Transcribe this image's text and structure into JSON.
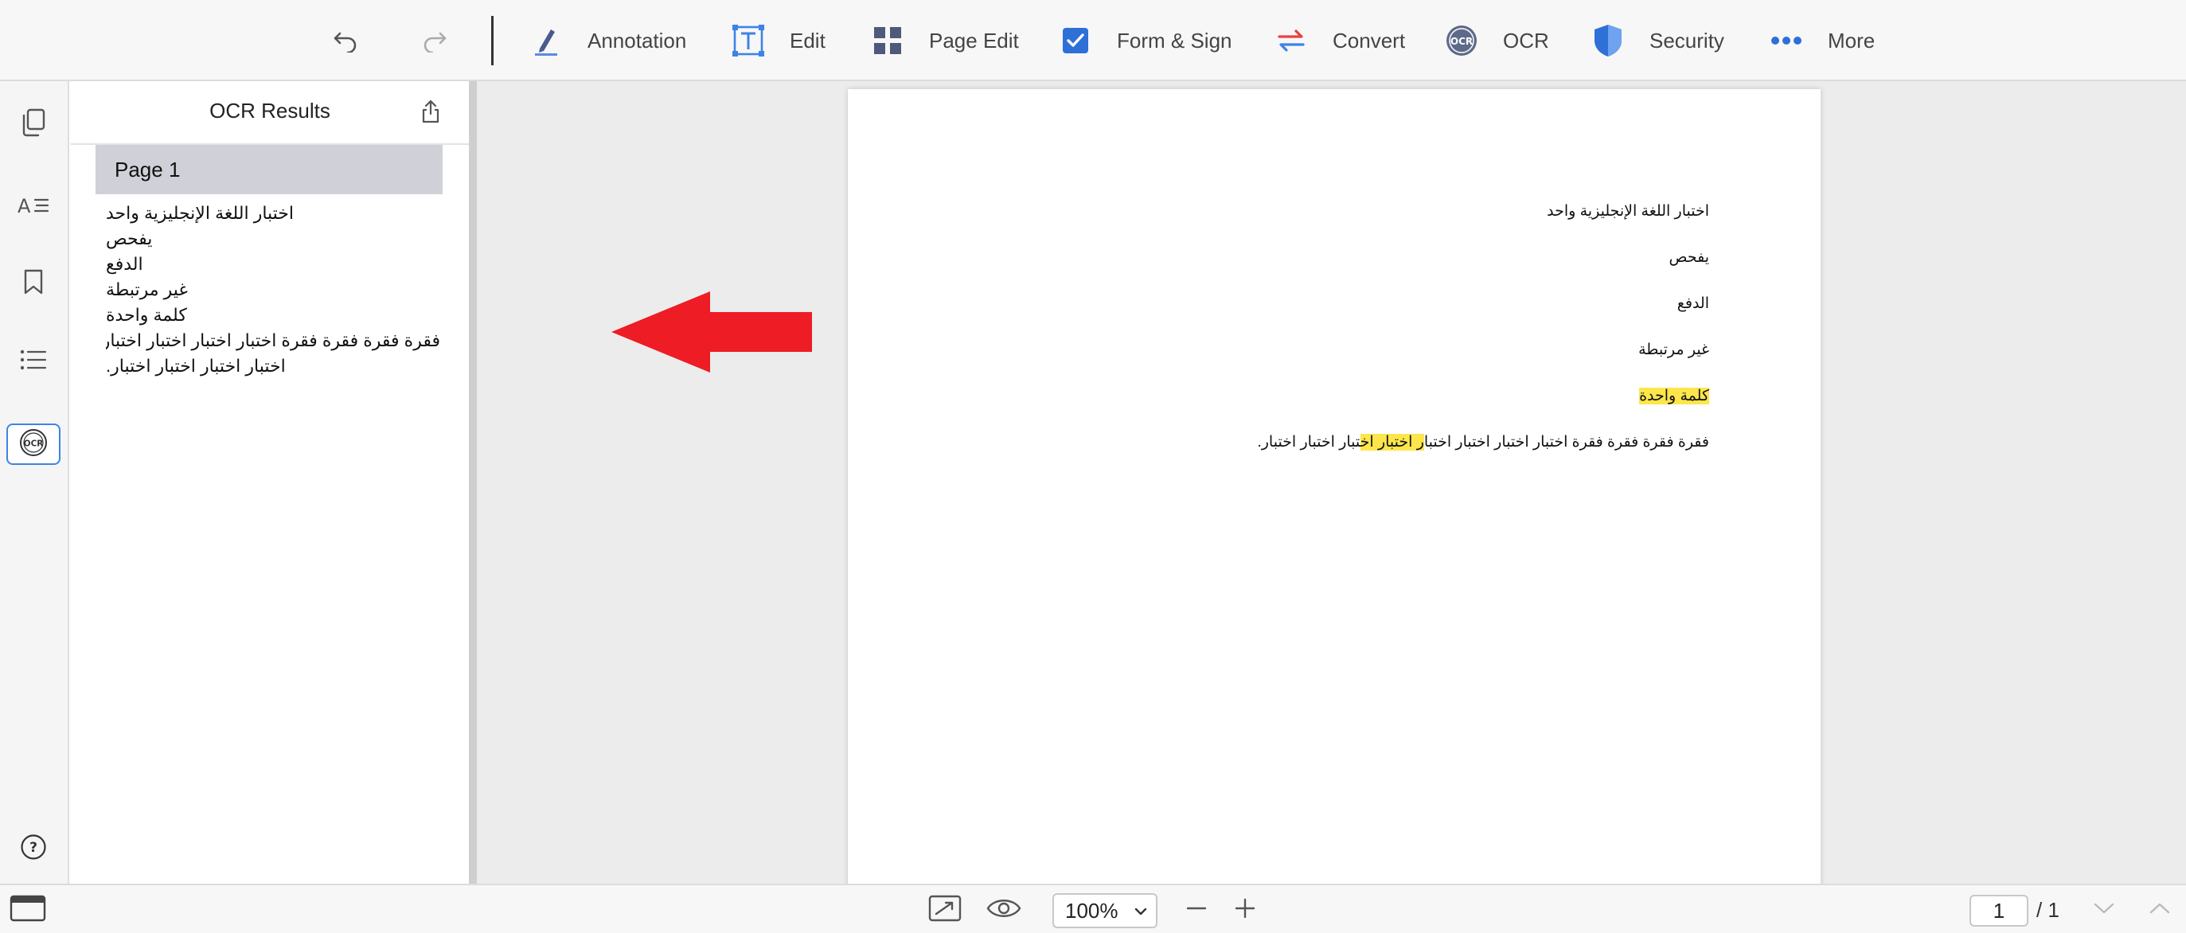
{
  "toolbar": {
    "annotation": "Annotation",
    "edit": "Edit",
    "page_edit": "Page Edit",
    "form_sign": "Form & Sign",
    "convert": "Convert",
    "ocr": "OCR",
    "security": "Security",
    "more": "More"
  },
  "panel": {
    "title": "OCR Results",
    "page_label": "Page 1",
    "lines": [
      "اختبار اللغة الإنجليزية واحد",
      "يفحص",
      "الدفع",
      "غير مرتبطة",
      "كلمة واحدة",
      "فقرة فقرة فقرة فقرة اختبار اختبار اختبار اختبار",
      "اختبار اختبار اختبار اختبار."
    ]
  },
  "document": {
    "line1": "اختبار اللغة الإنجليزية واحد",
    "line2": "يفحص",
    "line3": "الدفع",
    "line4": "غير مرتبطة",
    "line5": "كلمة واحدة",
    "line6_a": "فقرة فقرة فقرة فقرة اختبار اختبار اختبار اختبا",
    "line6_hl": "ر اختبار اخ",
    "line6_b": "تبار اختبار اختبار."
  },
  "statusbar": {
    "zoom": "100%",
    "page_current": "1",
    "page_total": "/ 1"
  },
  "icons": {
    "undo": "undo-icon",
    "redo": "redo-icon",
    "annotation": "pen-icon",
    "edit": "text-edit-icon",
    "page_edit": "grid-icon",
    "form_sign": "checkbox-icon",
    "convert": "convert-arrows-icon",
    "ocr": "ocr-icon",
    "security": "shield-icon",
    "more": "more-dots-icon"
  },
  "colors": {
    "accent": "#3d83e6",
    "highlight": "#fde64b",
    "arrow": "#ee1c24",
    "convert_red": "#e94040"
  }
}
